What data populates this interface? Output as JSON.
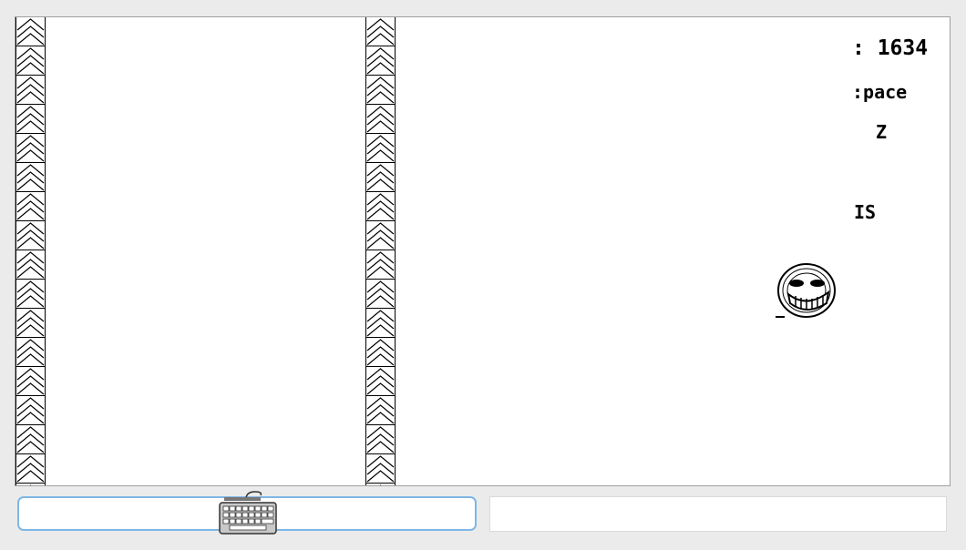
{
  "hud": {
    "score_line": ": 1634",
    "space_line": ":pace",
    "z_line": "Z",
    "s_line": "IS"
  },
  "icons": {
    "player": "troll-face-icon",
    "input_hint": "keyboard-icon",
    "wall_pattern": "chevron-up-icon"
  },
  "colors": {
    "background": "#ebebeb",
    "canvas": "#ffffff",
    "ink": "#000000",
    "input_focus_border": "#7fb6e6"
  },
  "input": {
    "value": "",
    "placeholder": ""
  },
  "output": {
    "text": ""
  }
}
